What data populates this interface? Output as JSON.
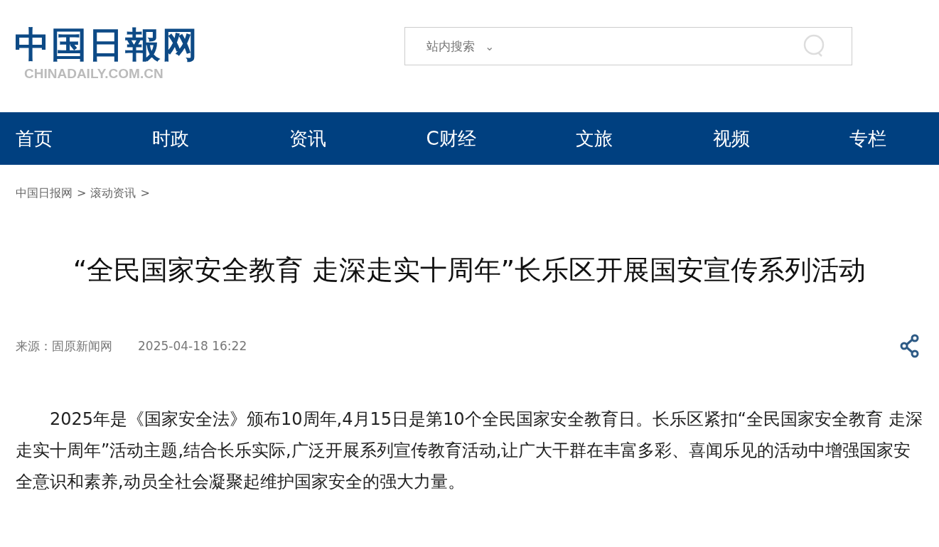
{
  "logo": {
    "title": "中国日報网",
    "subtitle": "CHINADAILY.COM.CN"
  },
  "search": {
    "scope": "站内搜索",
    "caret": "⌄"
  },
  "nav": [
    {
      "label": "首页"
    },
    {
      "label": "时政"
    },
    {
      "label": "资讯"
    },
    {
      "label": "C财经"
    },
    {
      "label": "文旅"
    },
    {
      "label": "视频"
    },
    {
      "label": "专栏"
    }
  ],
  "breadcrumb": [
    {
      "label": "中国日报网",
      "separator": ">"
    },
    {
      "label": "滚动资讯",
      "separator": ">"
    }
  ],
  "article": {
    "title": "“全民国家安全教育 走深走实十周年”长乐区开展国安宣传系列活动",
    "source": "来源：固原新闻网",
    "date": "2025-04-18 16:22",
    "paragraphs": [
      "2025年是《国家安全法》颁布10周年,4月15日是第10个全民国家安全教育日。长乐区紧扣“全民国家安全教育 走深走实十周年”活动主题,结合长乐实际,广泛开展系列宣传教育活动,让广大干群在丰富多彩、喜闻乐见的活动中增强国家安全意识和素养,动员全社会凝聚起维护国家安全的强大力量。"
    ]
  }
}
